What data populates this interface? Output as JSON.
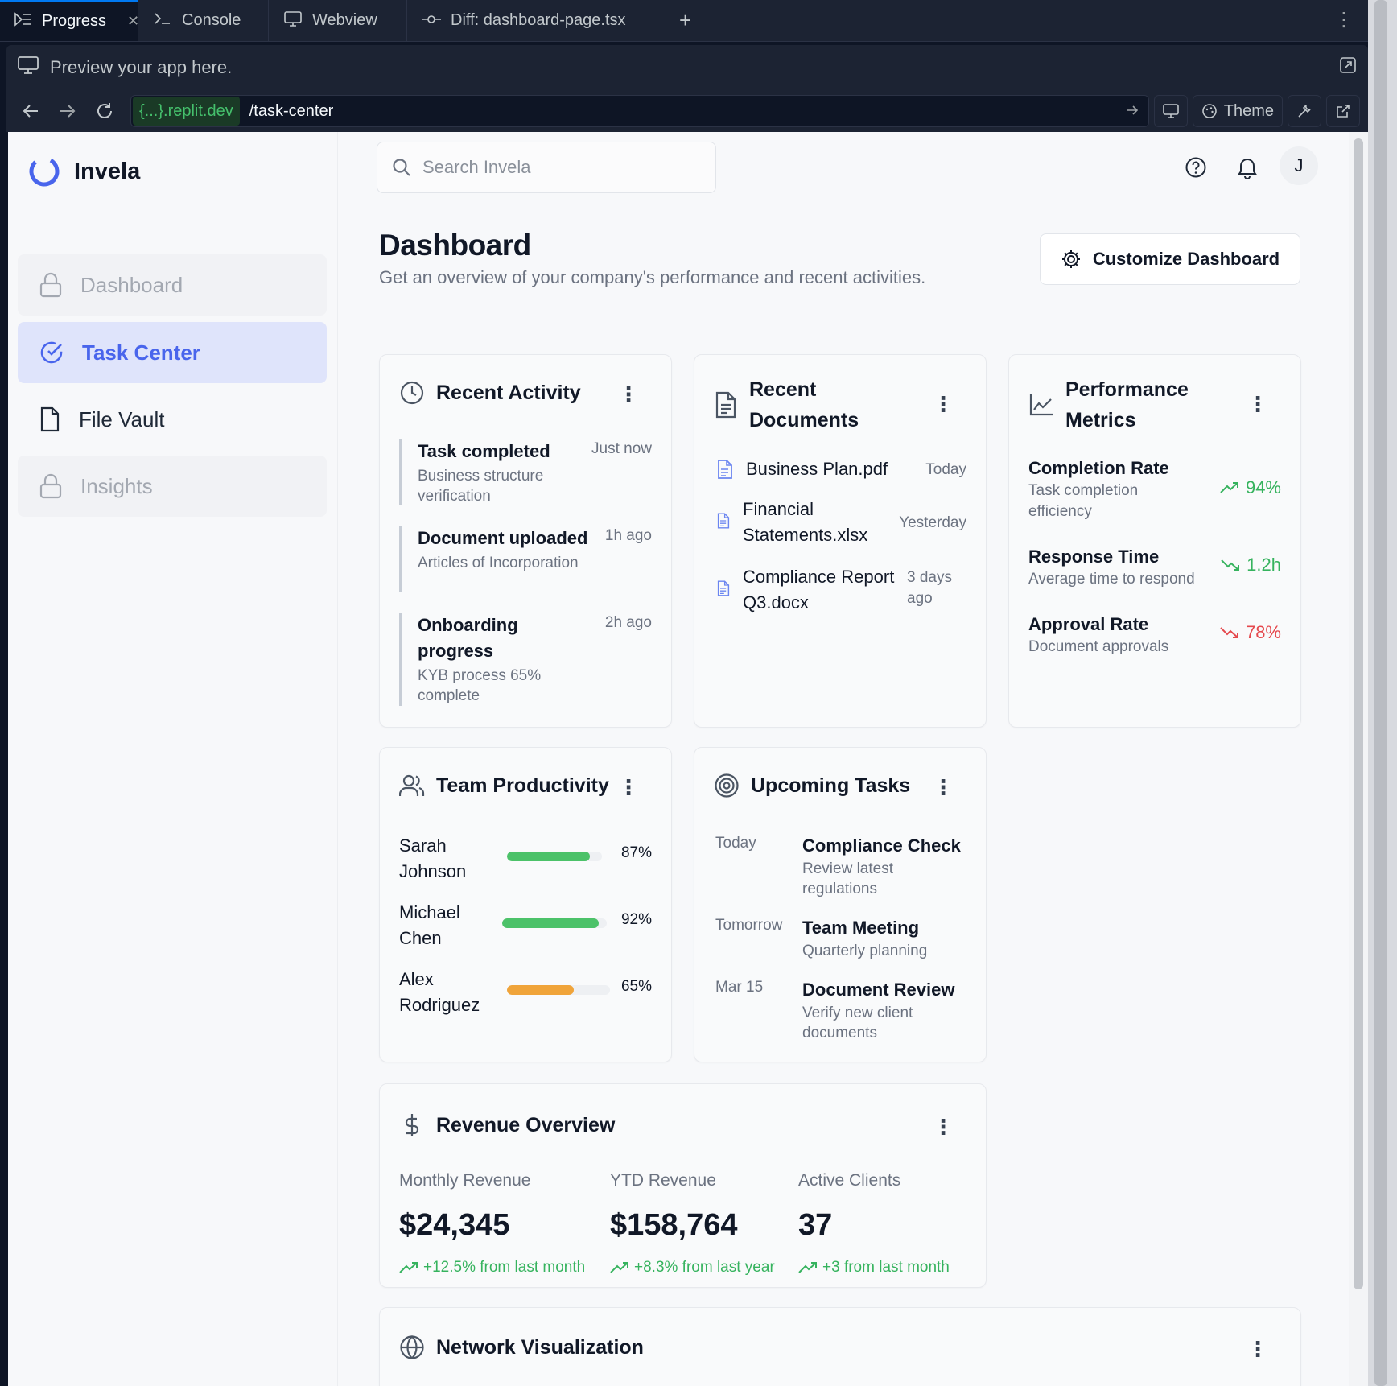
{
  "ide": {
    "tabs": [
      {
        "label": "Progress",
        "active": true,
        "icon": "progress-icon"
      },
      {
        "label": "Console",
        "icon": "terminal-icon"
      },
      {
        "label": "Webview",
        "icon": "monitor-icon"
      },
      {
        "label": "Diff: dashboard-page.tsx",
        "icon": "git-commit-icon"
      }
    ],
    "preview_text": "Preview your app here.",
    "url_domain": "{...}.replit.dev",
    "url_path": "/task-center",
    "theme_label": "Theme"
  },
  "app": {
    "brand": "Invela",
    "accent": "#4965ec",
    "nav": [
      {
        "label": "Dashboard",
        "state": "locked"
      },
      {
        "label": "Task Center",
        "state": "active"
      },
      {
        "label": "File Vault",
        "state": "normal"
      },
      {
        "label": "Insights",
        "state": "locked"
      }
    ],
    "search_placeholder": "Search Invela",
    "avatar_initial": "J",
    "page_title": "Dashboard",
    "page_subtitle": "Get an overview of your company's performance and recent activities.",
    "customize_label": "Customize Dashboard",
    "recent_activity": {
      "title": "Recent Activity",
      "items": [
        {
          "title": "Task completed",
          "desc": "Business structure verification",
          "time": "Just now"
        },
        {
          "title": "Document uploaded",
          "desc": "Articles of Incorporation",
          "time": "1h ago"
        },
        {
          "title": "Onboarding progress",
          "desc": "KYB process 65% complete",
          "time": "2h ago"
        }
      ]
    },
    "recent_documents": {
      "title": "Recent Documents",
      "items": [
        {
          "name": "Business Plan.pdf",
          "time": "Today"
        },
        {
          "name": "Financial Statements.xlsx",
          "time": "Yesterday"
        },
        {
          "name": "Compliance Report Q3.docx",
          "time": "3 days ago"
        }
      ]
    },
    "performance_metrics": {
      "title": "Performance Metrics",
      "items": [
        {
          "name": "Completion Rate",
          "desc": "Task completion efficiency",
          "value": "94%",
          "trend": "up",
          "color": "#36b35e"
        },
        {
          "name": "Response Time",
          "desc": "Average time to respond",
          "value": "1.2h",
          "trend": "down",
          "color": "#36b35e"
        },
        {
          "name": "Approval Rate",
          "desc": "Document approvals",
          "value": "78%",
          "trend": "down",
          "color": "#e5484d"
        }
      ]
    },
    "team_productivity": {
      "title": "Team Productivity",
      "members": [
        {
          "name": "Sarah Johnson",
          "pct_label": "87%",
          "fraction": 0.87,
          "color": "#4cc269"
        },
        {
          "name": "Michael Chen",
          "pct_label": "92%",
          "fraction": 0.92,
          "color": "#4cc269"
        },
        {
          "name": "Alex Rodriguez",
          "pct_label": "65%",
          "fraction": 0.65,
          "color": "#f0a43a"
        }
      ]
    },
    "upcoming_tasks": {
      "title": "Upcoming Tasks",
      "items": [
        {
          "when": "Today",
          "title": "Compliance Check",
          "desc": "Review latest regulations"
        },
        {
          "when": "Tomorrow",
          "title": "Team Meeting",
          "desc": "Quarterly planning"
        },
        {
          "when": "Mar 15",
          "title": "Document Review",
          "desc": "Verify new client documents"
        }
      ]
    },
    "revenue_overview": {
      "title": "Revenue Overview",
      "columns": [
        {
          "label": "Monthly Revenue",
          "value": "$24,345",
          "change": "+12.5% from last month"
        },
        {
          "label": "YTD Revenue",
          "value": "$158,764",
          "change": "+8.3% from last year"
        },
        {
          "label": "Active Clients",
          "value": "37",
          "change": "+3 from last month"
        }
      ]
    },
    "network_visualization": {
      "title": "Network Visualization"
    }
  }
}
